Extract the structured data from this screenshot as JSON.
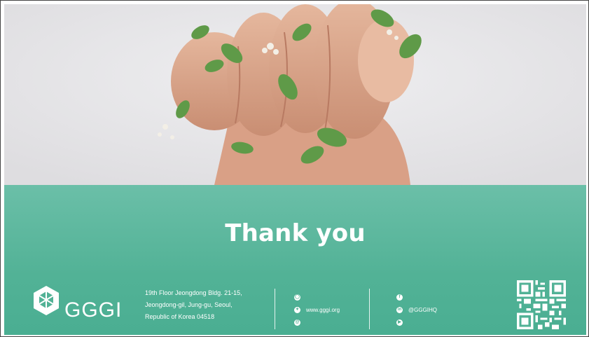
{
  "slide": {
    "title": "Thank you",
    "brand": {
      "logo_text": "GGGI",
      "accent_color": "#52b296"
    },
    "address": [
      "19th Floor Jeongdong Bldg. 21-15,",
      "Jeongdong-gil, Jung-gu, Seoul,",
      "Republic of Korea 04518"
    ],
    "web": {
      "icons": [
        "globe-icon",
        "twitter-icon",
        "at-icon"
      ],
      "url": "www.gggi.org"
    },
    "social": {
      "icons": [
        "facebook-icon",
        "linkedin-icon",
        "youtube-icon"
      ],
      "handle": "@GGGIHQ"
    },
    "photo": {
      "subject": "fist-with-herbs"
    }
  }
}
